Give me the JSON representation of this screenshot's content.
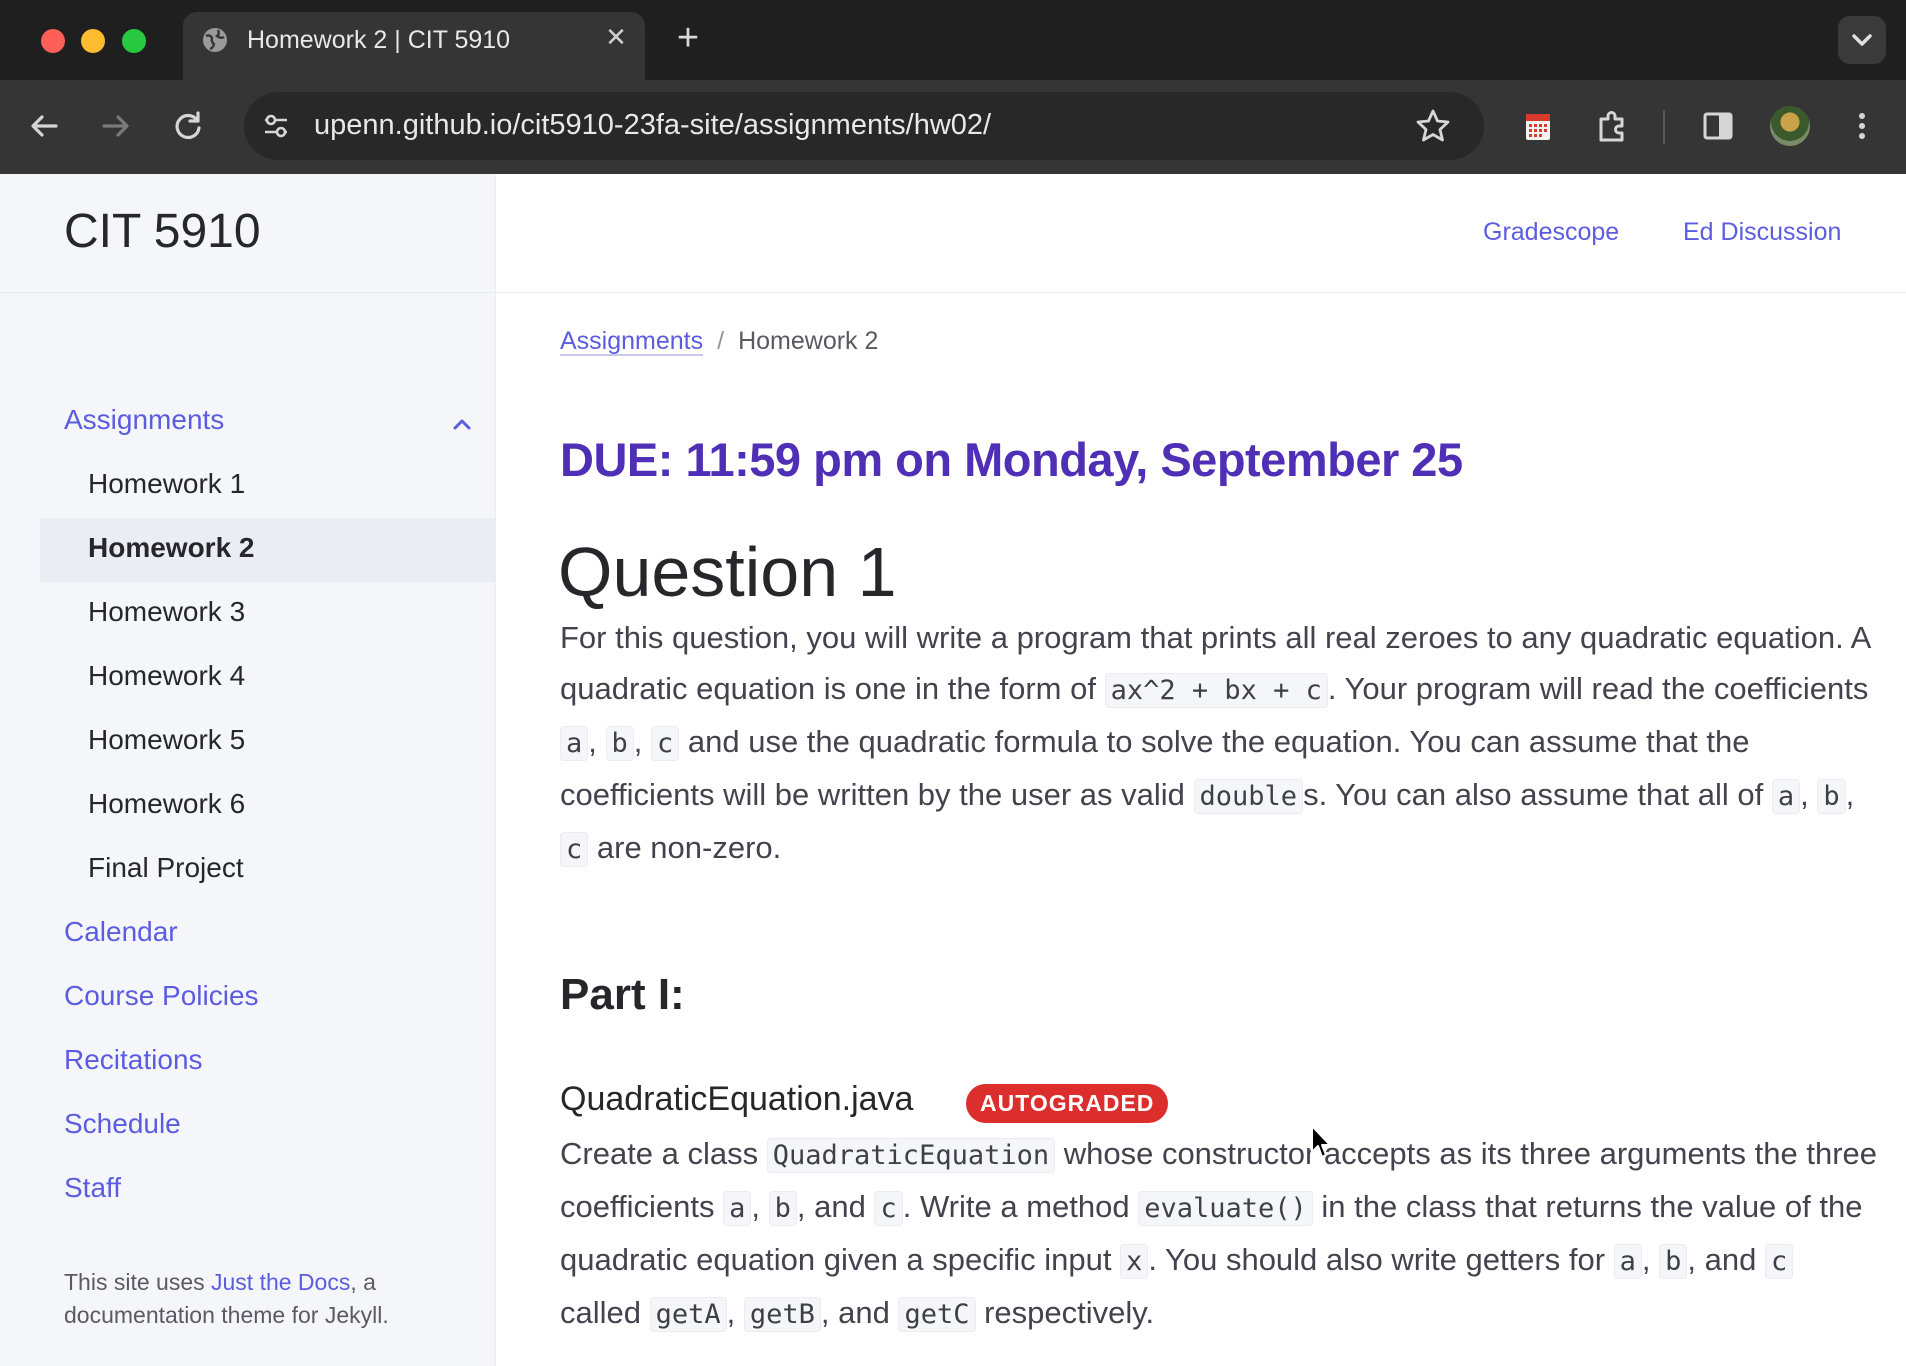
{
  "browser": {
    "tab_title": "Homework 2 | CIT 5910",
    "close_glyph": "✕",
    "new_tab_glyph": "+",
    "url": "upenn.github.io/cit5910-23fa-site/assignments/hw02/"
  },
  "site": {
    "title": "CIT 5910",
    "aux_links": [
      "Gradescope",
      "Ed Discussion"
    ]
  },
  "sidebar": {
    "assignments_label": "Assignments",
    "children": [
      "Homework 1",
      "Homework 2",
      "Homework 3",
      "Homework 4",
      "Homework 5",
      "Homework 6",
      "Final Project"
    ],
    "active_child": "Homework 2",
    "links": [
      "Calendar",
      "Course Policies",
      "Recitations",
      "Schedule",
      "Staff"
    ],
    "footer": {
      "prefix": "This site uses ",
      "link": "Just the Docs",
      "suffix": ", a documentation theme for Jekyll."
    }
  },
  "breadcrumb": {
    "parent": "Assignments",
    "separator": "/",
    "current": "Homework 2"
  },
  "content": {
    "due": "DUE: 11:59 pm on Monday, September 25",
    "question_title": "Question 1",
    "intro": {
      "t1": "For this question, you will write a program that prints all real zeroes to any quadratic equation. A quadratic equation is one in the form of ",
      "c1": "ax^2 + bx + c",
      "t2": ". Your program will read the coefficients ",
      "c2": "a",
      "t3": ", ",
      "c3": "b",
      "t4": ", ",
      "c4": "c",
      "t5": " and use the quadratic formula to solve the equation. You can assume that the coefficients will be written by the user as valid ",
      "c5": "double",
      "t6": "s. You can also assume that all of ",
      "c6": "a",
      "t7": ", ",
      "c7": "b",
      "t8": ", ",
      "c8": "c",
      "t9": " are non-zero."
    },
    "part_title": "Part I:",
    "file_title": "QuadraticEquation.java",
    "file_badge": "AUTOGRADED",
    "desc": {
      "t1": "Create a class ",
      "c1": "QuadraticEquation",
      "t2": " whose constructor accepts as its three arguments the three coefficients ",
      "c2": "a",
      "t3": ", ",
      "c3": "b",
      "t4": ", and ",
      "c4": "c",
      "t5": ". Write a method ",
      "c5": "evaluate()",
      "t6": " in the class that returns the value of the quadratic equation given a specific input ",
      "c6": "x",
      "t7": ". You should also write getters for ",
      "c7": "a",
      "t8": ", ",
      "c8": "b",
      "t9": ", and ",
      "c9": "c",
      "t10": " called ",
      "c10": "getA",
      "t11": ", ",
      "c11": "getB",
      "t12": ", and ",
      "c12": "getC",
      "t13": " respectively."
    }
  },
  "colors": {
    "link": "#5c5ce0",
    "due": "#4f2fb5",
    "badge": "#dd2e2e"
  },
  "icons": [
    "globe-icon",
    "back-icon",
    "forward-icon",
    "reload-icon",
    "site-settings-icon",
    "bookmark-star-icon",
    "calendar-extension-icon",
    "extensions-puzzle-icon",
    "side-panel-icon",
    "profile-avatar",
    "more-menu-icon",
    "chevron-up-icon",
    "tab-search-chevron-icon"
  ]
}
